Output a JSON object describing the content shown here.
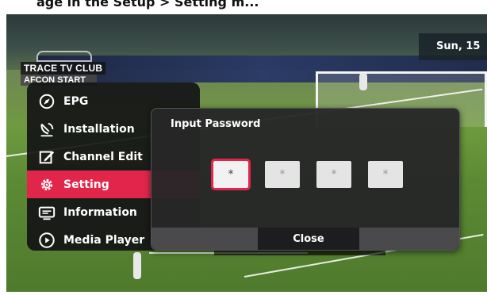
{
  "photo": {
    "top_caption": "age in the Setup > Setting m..."
  },
  "channel_logo": {
    "line1": "TRACE TV CLUB",
    "line2": "AFCON START"
  },
  "clock": {
    "text": "Sun, 15"
  },
  "menu": {
    "accent_color": "#e2264b",
    "items": [
      {
        "label": "EPG",
        "icon": "compass-icon",
        "active": false
      },
      {
        "label": "Installation",
        "icon": "satellite-dish-icon",
        "active": false
      },
      {
        "label": "Channel Edit",
        "icon": "edit-icon",
        "active": false
      },
      {
        "label": "Setting",
        "icon": "gear-icon",
        "active": true
      },
      {
        "label": "Information",
        "icon": "info-screen-icon",
        "active": false
      },
      {
        "label": "Media Player",
        "icon": "play-icon",
        "active": false
      }
    ]
  },
  "password_dialog": {
    "title": "Input Password",
    "digits": [
      "*",
      "*",
      "*",
      "*"
    ],
    "focused_index": 0,
    "close_label": "Close"
  }
}
